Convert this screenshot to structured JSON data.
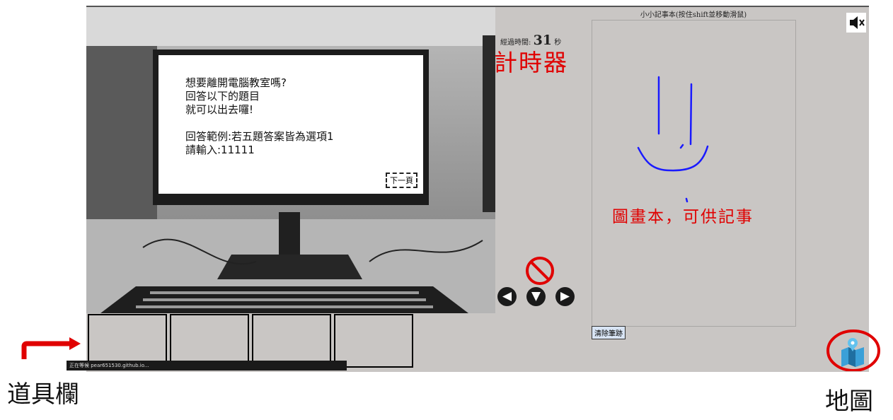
{
  "game": {
    "screen_message": "想要離開電腦教室嗎?\n回答以下的題目\n就可以出去囉!\n\n回答範例:若五題答案皆為選項1\n請輸入:11111",
    "next_button": "下一頁",
    "timer": {
      "label": "經過時間:",
      "value": "31",
      "unit": "秒"
    },
    "notepad": {
      "title": "小小記事本(按住shift並移動滑鼠)",
      "clear_button": "清除筆跡"
    },
    "status_bar": "正在等候 pear651530.github.io..."
  },
  "annotations": {
    "timer_label": "計時器",
    "notepad_label": "圖畫本，可供記事",
    "inventory_label": "道具欄",
    "map_label": "地圖"
  },
  "icons": {
    "speaker": "speaker-muted-icon",
    "no_entry": "no-entry-icon",
    "arrows": [
      "arrow-left-icon",
      "arrow-down-icon",
      "arrow-right-icon"
    ],
    "map": "map-icon"
  },
  "colors": {
    "annotation": "#e00000",
    "drawing": "#1a1aff"
  }
}
